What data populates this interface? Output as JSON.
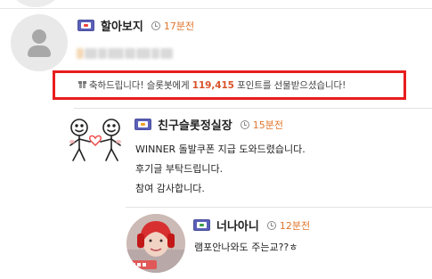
{
  "comments": [
    {
      "nickname": "할아보지",
      "time": "17분전",
      "avatar": "default-person-icon",
      "gift_notice": {
        "prefix": "축하드립니다! 슬롯봇에게",
        "points": "119,415",
        "suffix": "포인트를 선물받으셨습니다!"
      }
    },
    {
      "nickname": "친구슬롯정실장",
      "time": "15분전",
      "avatar": "stick-figures-heart-icon",
      "lines": [
        "WINNER 돌발쿠폰 지급 도와드렸습니다.",
        "후기글 부탁드립니다.",
        "참여 감사합니다."
      ]
    },
    {
      "nickname": "너나아니",
      "time": "12분전",
      "avatar": "photo-avatar",
      "lines": [
        "램포안나와도 주는교??ㅎ"
      ]
    }
  ],
  "colors": {
    "highlight_border": "#e81d1d",
    "points_color": "#d9532a",
    "time_color": "#e0762c"
  }
}
